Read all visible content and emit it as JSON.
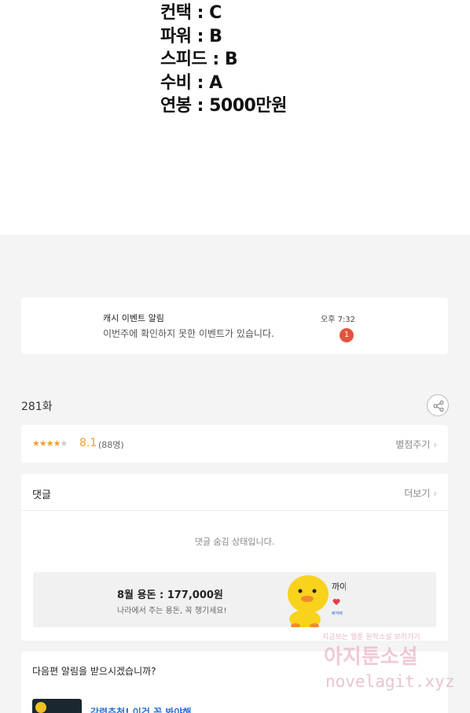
{
  "story_stats": [
    "컨택 : C",
    "파워 : B",
    "스피드 : B",
    "수비 : A",
    "연봉 : 5000만원"
  ],
  "notification": {
    "title": "캐시 이벤트 알림",
    "body": "이번주에 확인하지 못한 이벤트가 있습니다.",
    "time": "오후 7:32",
    "badge_count": "1"
  },
  "episode": {
    "title": "281화"
  },
  "rating": {
    "score": "8.1",
    "count": "(88명)",
    "stars_filled": 4,
    "stars_total": 5,
    "rate_label": "별점주기",
    "star_color": "#f0a030"
  },
  "comments": {
    "header": "댓글",
    "more_label": "더보기",
    "hidden_message": "댓글 숨김 상태입니다."
  },
  "ad": {
    "title": "8월 용돈 : 177,000원",
    "subtitle": "나라에서 주는 용돈, 꼭 챙기세요!",
    "sticker_text": "까아",
    "sticker_credit": "삐약삐"
  },
  "next_episode": {
    "question": "다음편 알림을 받으시겠습니까?",
    "link_text": "강력추천! 이건 꼭 봐야해"
  },
  "watermark": {
    "tagline": "지금보는 웹툰 원작소설 보러가기",
    "brand": "아지툰소설",
    "url": "novelagit.xyz"
  },
  "colors": {
    "badge": "#e3533b",
    "link": "#2a6fd6",
    "background": "#f4f4f4"
  }
}
